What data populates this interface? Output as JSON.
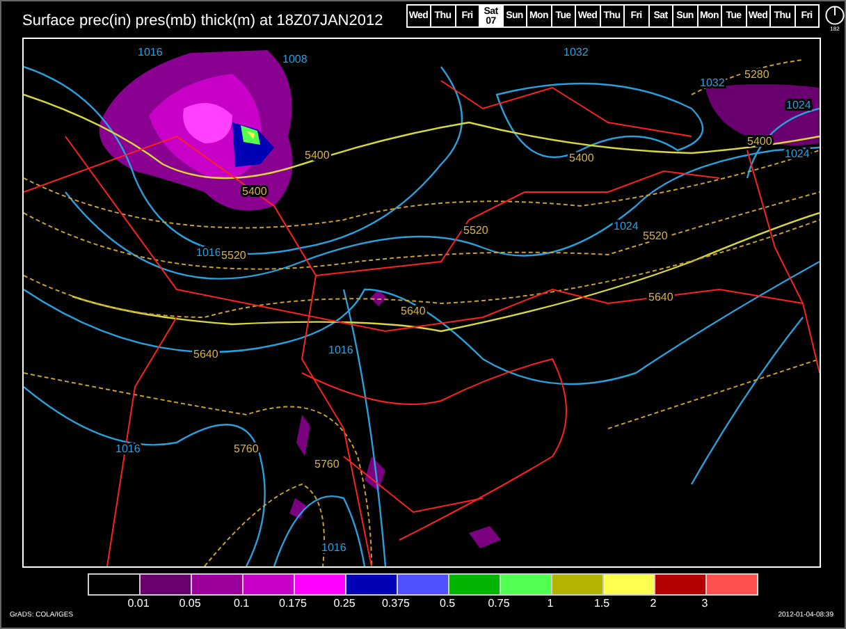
{
  "title": "Surface prec(in) pres(mb) thick(m) at 18Z07JAN2012",
  "days": [
    {
      "label": "Wed",
      "selected": false
    },
    {
      "label": "Thu",
      "selected": false
    },
    {
      "label": "Fri",
      "selected": false
    },
    {
      "label": "Sat",
      "sub": "07",
      "selected": true
    },
    {
      "label": "Sun",
      "selected": false
    },
    {
      "label": "Mon",
      "selected": false
    },
    {
      "label": "Tue",
      "selected": false
    },
    {
      "label": "Wed",
      "selected": false
    },
    {
      "label": "Thu",
      "selected": false
    },
    {
      "label": "Fri",
      "selected": false
    },
    {
      "label": "Sat",
      "selected": false
    },
    {
      "label": "Sun",
      "selected": false
    },
    {
      "label": "Mon",
      "selected": false
    },
    {
      "label": "Tue",
      "selected": false
    },
    {
      "label": "Wed",
      "selected": false
    },
    {
      "label": "Thu",
      "selected": false
    },
    {
      "label": "Fri",
      "selected": false
    }
  ],
  "dial_label": "182",
  "map_labels": [
    {
      "text": "1016",
      "kind": "isobar"
    },
    {
      "text": "1008",
      "kind": "isobar"
    },
    {
      "text": "5400",
      "kind": "thickness"
    },
    {
      "text": "5400",
      "kind": "thickness"
    },
    {
      "text": "1016",
      "kind": "isobar"
    },
    {
      "text": "5520",
      "kind": "thickness"
    },
    {
      "text": "5640",
      "kind": "thickness"
    },
    {
      "text": "1032",
      "kind": "isobar"
    },
    {
      "text": "5280",
      "kind": "thickness"
    },
    {
      "text": "1032",
      "kind": "isobar"
    },
    {
      "text": "1024",
      "kind": "isobar"
    },
    {
      "text": "5400",
      "kind": "thickness"
    },
    {
      "text": "1024",
      "kind": "isobar"
    },
    {
      "text": "5400",
      "kind": "thickness"
    },
    {
      "text": "5520",
      "kind": "thickness"
    },
    {
      "text": "1024",
      "kind": "isobar"
    },
    {
      "text": "5520",
      "kind": "thickness"
    },
    {
      "text": "5640",
      "kind": "thickness"
    },
    {
      "text": "5640",
      "kind": "thickness"
    },
    {
      "text": "1016",
      "kind": "isobar"
    },
    {
      "text": "1016",
      "kind": "isobar"
    },
    {
      "text": "5760",
      "kind": "thickness"
    },
    {
      "text": "5760",
      "kind": "thickness"
    },
    {
      "text": "1016",
      "kind": "isobar"
    }
  ],
  "legend": {
    "bins": [
      {
        "color": "#000000"
      },
      {
        "color": "#6a0070"
      },
      {
        "color": "#9c009c"
      },
      {
        "color": "#c800c8"
      },
      {
        "color": "#ff00ff"
      },
      {
        "color": "#0000b4"
      },
      {
        "color": "#5050ff"
      },
      {
        "color": "#00b400"
      },
      {
        "color": "#50ff50"
      },
      {
        "color": "#b4b400"
      },
      {
        "color": "#ffff50"
      },
      {
        "color": "#b40000"
      },
      {
        "color": "#ff5050"
      }
    ],
    "labels": [
      "0.01",
      "0.05",
      "0.1",
      "0.175",
      "0.25",
      "0.375",
      "0.5",
      "0.75",
      "1",
      "1.5",
      "2",
      "3"
    ]
  },
  "footer_left": "GrADS: COLA/IGES",
  "footer_right": "2012-01-04-08:39"
}
